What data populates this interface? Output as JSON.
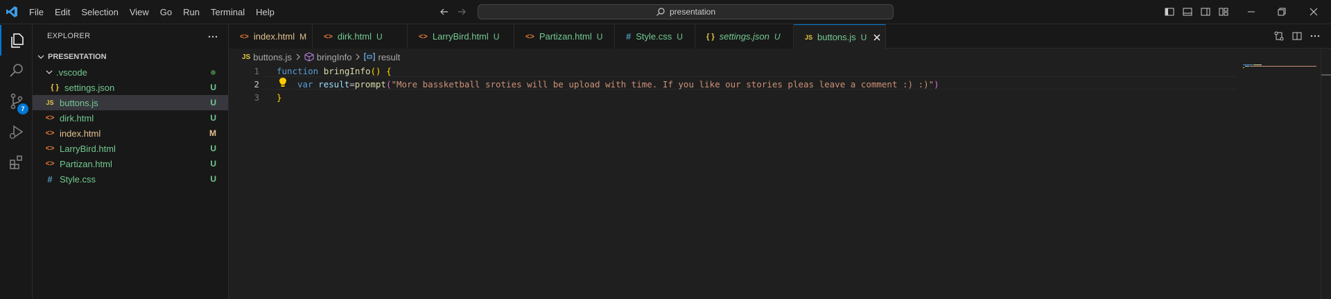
{
  "titlebar": {
    "menu": [
      "File",
      "Edit",
      "Selection",
      "View",
      "Go",
      "Run",
      "Terminal",
      "Help"
    ],
    "search_text": "presentation"
  },
  "activity": {
    "scm_badge": "7"
  },
  "sidebar": {
    "title": "EXPLORER",
    "section": "PRESENTATION",
    "items": [
      {
        "name": ".vscode",
        "icon": "",
        "status": "",
        "color": "#73c991"
      },
      {
        "name": "settings.json",
        "icon": "{ }",
        "status": "U",
        "color": "#73c991"
      },
      {
        "name": "buttons.js",
        "icon": "JS",
        "status": "U",
        "color": "#73c991"
      },
      {
        "name": "dirk.html",
        "icon": "<>",
        "status": "U",
        "color": "#73c991"
      },
      {
        "name": "index.html",
        "icon": "<>",
        "status": "M",
        "color": "#e2c08d"
      },
      {
        "name": "LarryBird.html",
        "icon": "<>",
        "status": "U",
        "color": "#73c991"
      },
      {
        "name": "Partizan.html",
        "icon": "<>",
        "status": "U",
        "color": "#73c991"
      },
      {
        "name": "Style.css",
        "icon": "#",
        "status": "U",
        "color": "#73c991"
      }
    ]
  },
  "tabs": [
    {
      "name": "index.html",
      "icon": "<>",
      "status": "M"
    },
    {
      "name": "dirk.html",
      "icon": "<>",
      "status": "U"
    },
    {
      "name": "LarryBird.html",
      "icon": "<>",
      "status": "U"
    },
    {
      "name": "Partizan.html",
      "icon": "<>",
      "status": "U"
    },
    {
      "name": "Style.css",
      "icon": "#",
      "status": "U"
    },
    {
      "name": "settings.json",
      "icon": "{ }",
      "status": "U"
    },
    {
      "name": "buttons.js",
      "icon": "JS",
      "status": "U"
    }
  ],
  "breadcrumb": {
    "file": "buttons.js",
    "file_icon": "JS",
    "function": "bringInfo",
    "variable": "result"
  },
  "code": {
    "line_numbers": [
      "1",
      "2",
      "3"
    ],
    "line1": {
      "kw": "function",
      "name": "bringInfo",
      "paren": "()",
      "brace": "{"
    },
    "line2": {
      "kw": "var",
      "name": "result",
      "op": "=",
      "fn": "prompt",
      "open": "(",
      "str": "\"More bassketball sroties will be upload with time. If you like our stories pleas leave a comment :) :)\"",
      "close": ")"
    },
    "line3": {
      "brace": "}"
    }
  },
  "colors": {
    "accent": "#0078d4",
    "untracked": "#73c991",
    "modified": "#e2c08d"
  }
}
